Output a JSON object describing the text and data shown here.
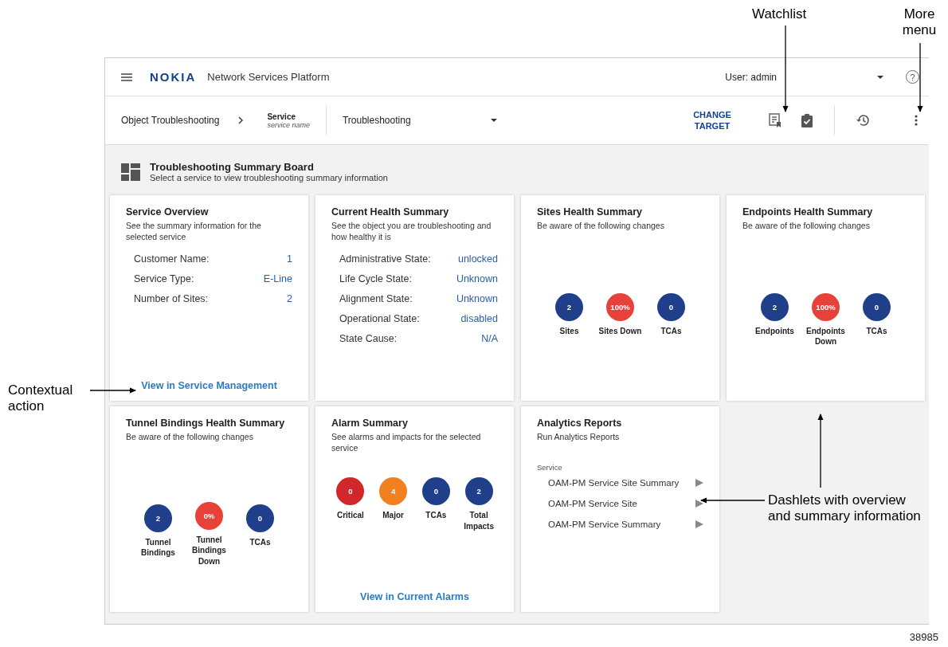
{
  "header": {
    "logo": "NOKIA",
    "app_title": "Network Services Platform",
    "user": "User: admin",
    "help": "?"
  },
  "toolbar": {
    "breadcrumb": "Object Troubleshooting",
    "target_label": "Service",
    "target_value": "service name",
    "view": "Troubleshooting",
    "change_target": "CHANGE TARGET"
  },
  "board": {
    "title": "Troubleshooting Summary Board",
    "subtitle": "Select a service to view troubleshooting summary information"
  },
  "dashlets": [
    {
      "kind": "info",
      "title": "Service Overview",
      "subtitle": "See the summary information for the selected service",
      "rows": [
        {
          "label": "Customer Name:",
          "value": "1"
        },
        {
          "label": "Service Type:",
          "value": "E-Line"
        },
        {
          "label": "Number of Sites:",
          "value": "2"
        }
      ],
      "link": "View in Service Management"
    },
    {
      "kind": "info",
      "title": "Current Health Summary",
      "subtitle": "See the object you are troubleshooting and how healthy it is",
      "rows": [
        {
          "label": "Administrative State:",
          "value": "unlocked"
        },
        {
          "label": "Life Cycle State:",
          "value": "Unknown"
        },
        {
          "label": "Alignment State:",
          "value": "Unknown"
        },
        {
          "label": "Operational State:",
          "value": "disabled"
        },
        {
          "label": "State Cause:",
          "value": "N/A"
        }
      ]
    },
    {
      "kind": "metrics",
      "title": "Sites Health Summary",
      "subtitle": "Be aware of the following changes",
      "metrics": [
        {
          "value": "2",
          "label": "Sites",
          "color": "#1f3f8a"
        },
        {
          "value": "100%",
          "label": "Sites Down",
          "color": "#e8413a"
        },
        {
          "value": "0",
          "label": "TCAs",
          "color": "#1f3f8a"
        }
      ]
    },
    {
      "kind": "metrics",
      "title": "Endpoints Health Summary",
      "subtitle": "Be aware of the following changes",
      "metrics": [
        {
          "value": "2",
          "label": "Endpoints",
          "color": "#1f3f8a"
        },
        {
          "value": "100%",
          "label": "Endpoints Down",
          "color": "#e8413a"
        },
        {
          "value": "0",
          "label": "TCAs",
          "color": "#1f3f8a"
        }
      ]
    },
    {
      "kind": "metrics",
      "title": "Tunnel Bindings Health Summary",
      "subtitle": "Be aware of the following changes",
      "metrics": [
        {
          "value": "2",
          "label": "Tunnel Bindings",
          "color": "#1f3f8a"
        },
        {
          "value": "0%",
          "label": "Tunnel Bindings Down",
          "color": "#e8413a"
        },
        {
          "value": "0",
          "label": "TCAs",
          "color": "#1f3f8a"
        }
      ]
    },
    {
      "kind": "metrics",
      "title": "Alarm Summary",
      "subtitle": "See alarms and impacts for the selected service",
      "metrics": [
        {
          "value": "0",
          "label": "Critical",
          "color": "#d0282a"
        },
        {
          "value": "4",
          "label": "Major",
          "color": "#f08020"
        },
        {
          "value": "0",
          "label": "TCAs",
          "color": "#1f3f8a"
        },
        {
          "value": "2",
          "label": "Total Impacts",
          "color": "#1f3f8a"
        }
      ],
      "link": "View in Current Alarms"
    },
    {
      "kind": "reports",
      "title": "Analytics Reports",
      "subtitle": "Run Analytics Reports",
      "section": "Service",
      "reports": [
        "OAM-PM Service Site Summary",
        "OAM-PM Service Site",
        "OAM-PM Service Summary"
      ]
    }
  ],
  "callouts": [
    {
      "text": "Watchlist"
    },
    {
      "text": "More menu"
    },
    {
      "text": "Contextual action"
    },
    {
      "text": "Dashlets with overview and summary information"
    }
  ],
  "figure_number": "38985"
}
